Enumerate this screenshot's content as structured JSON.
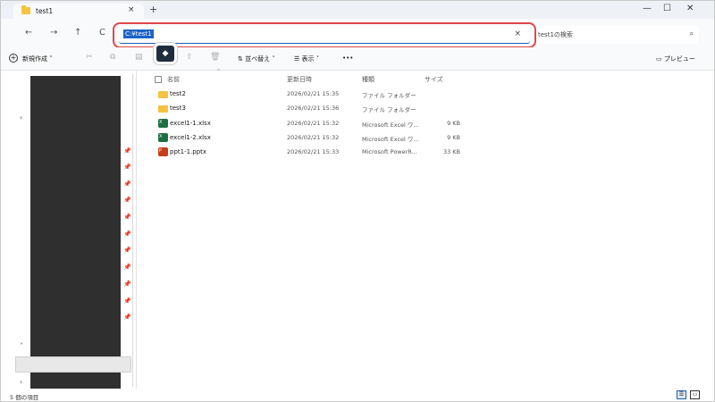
{
  "window": {
    "tab_title": "test1",
    "tab_close": "×",
    "new_tab": "+",
    "minimize": "—",
    "maximize": "☐",
    "close": "✕"
  },
  "nav": {
    "back": "←",
    "forward": "→",
    "up": "↑",
    "refresh": "C"
  },
  "address": {
    "path": "C:¥test1",
    "clear": "×"
  },
  "search": {
    "placeholder": "test1の検索",
    "icon": "search-icon"
  },
  "toolbar": {
    "new_label": "新規作成",
    "sort_label": "並べ替え",
    "view_label": "表示",
    "more_label": "•••",
    "preview_label": "プレビュー"
  },
  "columns": {
    "name": "名前",
    "date": "更新日時",
    "type": "種類",
    "size": "サイズ"
  },
  "files": [
    {
      "name": "test2",
      "date": "2026/02/21 15:35",
      "type": "ファイル フォルダー",
      "size": "",
      "icon": "folder-icon"
    },
    {
      "name": "test3",
      "date": "2026/02/21 15:36",
      "type": "ファイル フォルダー",
      "size": "",
      "icon": "folder-icon"
    },
    {
      "name": "excel1-1.xlsx",
      "date": "2026/02/21 15:32",
      "type": "Microsoft Excel ワ...",
      "size": "9 KB",
      "icon": "excel-file-icon"
    },
    {
      "name": "excel1-2.xlsx",
      "date": "2026/02/21 15:32",
      "type": "Microsoft Excel ワ...",
      "size": "9 KB",
      "icon": "excel-file-icon"
    },
    {
      "name": "ppt1-1.pptx",
      "date": "2026/02/21 15:33",
      "type": "Microsoft PowerR...",
      "size": "33 KB",
      "icon": "powerpoint-file-icon"
    }
  ],
  "status": {
    "item_count": "5 個の項目"
  },
  "colors": {
    "highlight": "#e04848",
    "selection": "#1a64c8",
    "folder": "#f5c242",
    "excel": "#1d6f42",
    "powerpoint": "#c43e1c"
  }
}
